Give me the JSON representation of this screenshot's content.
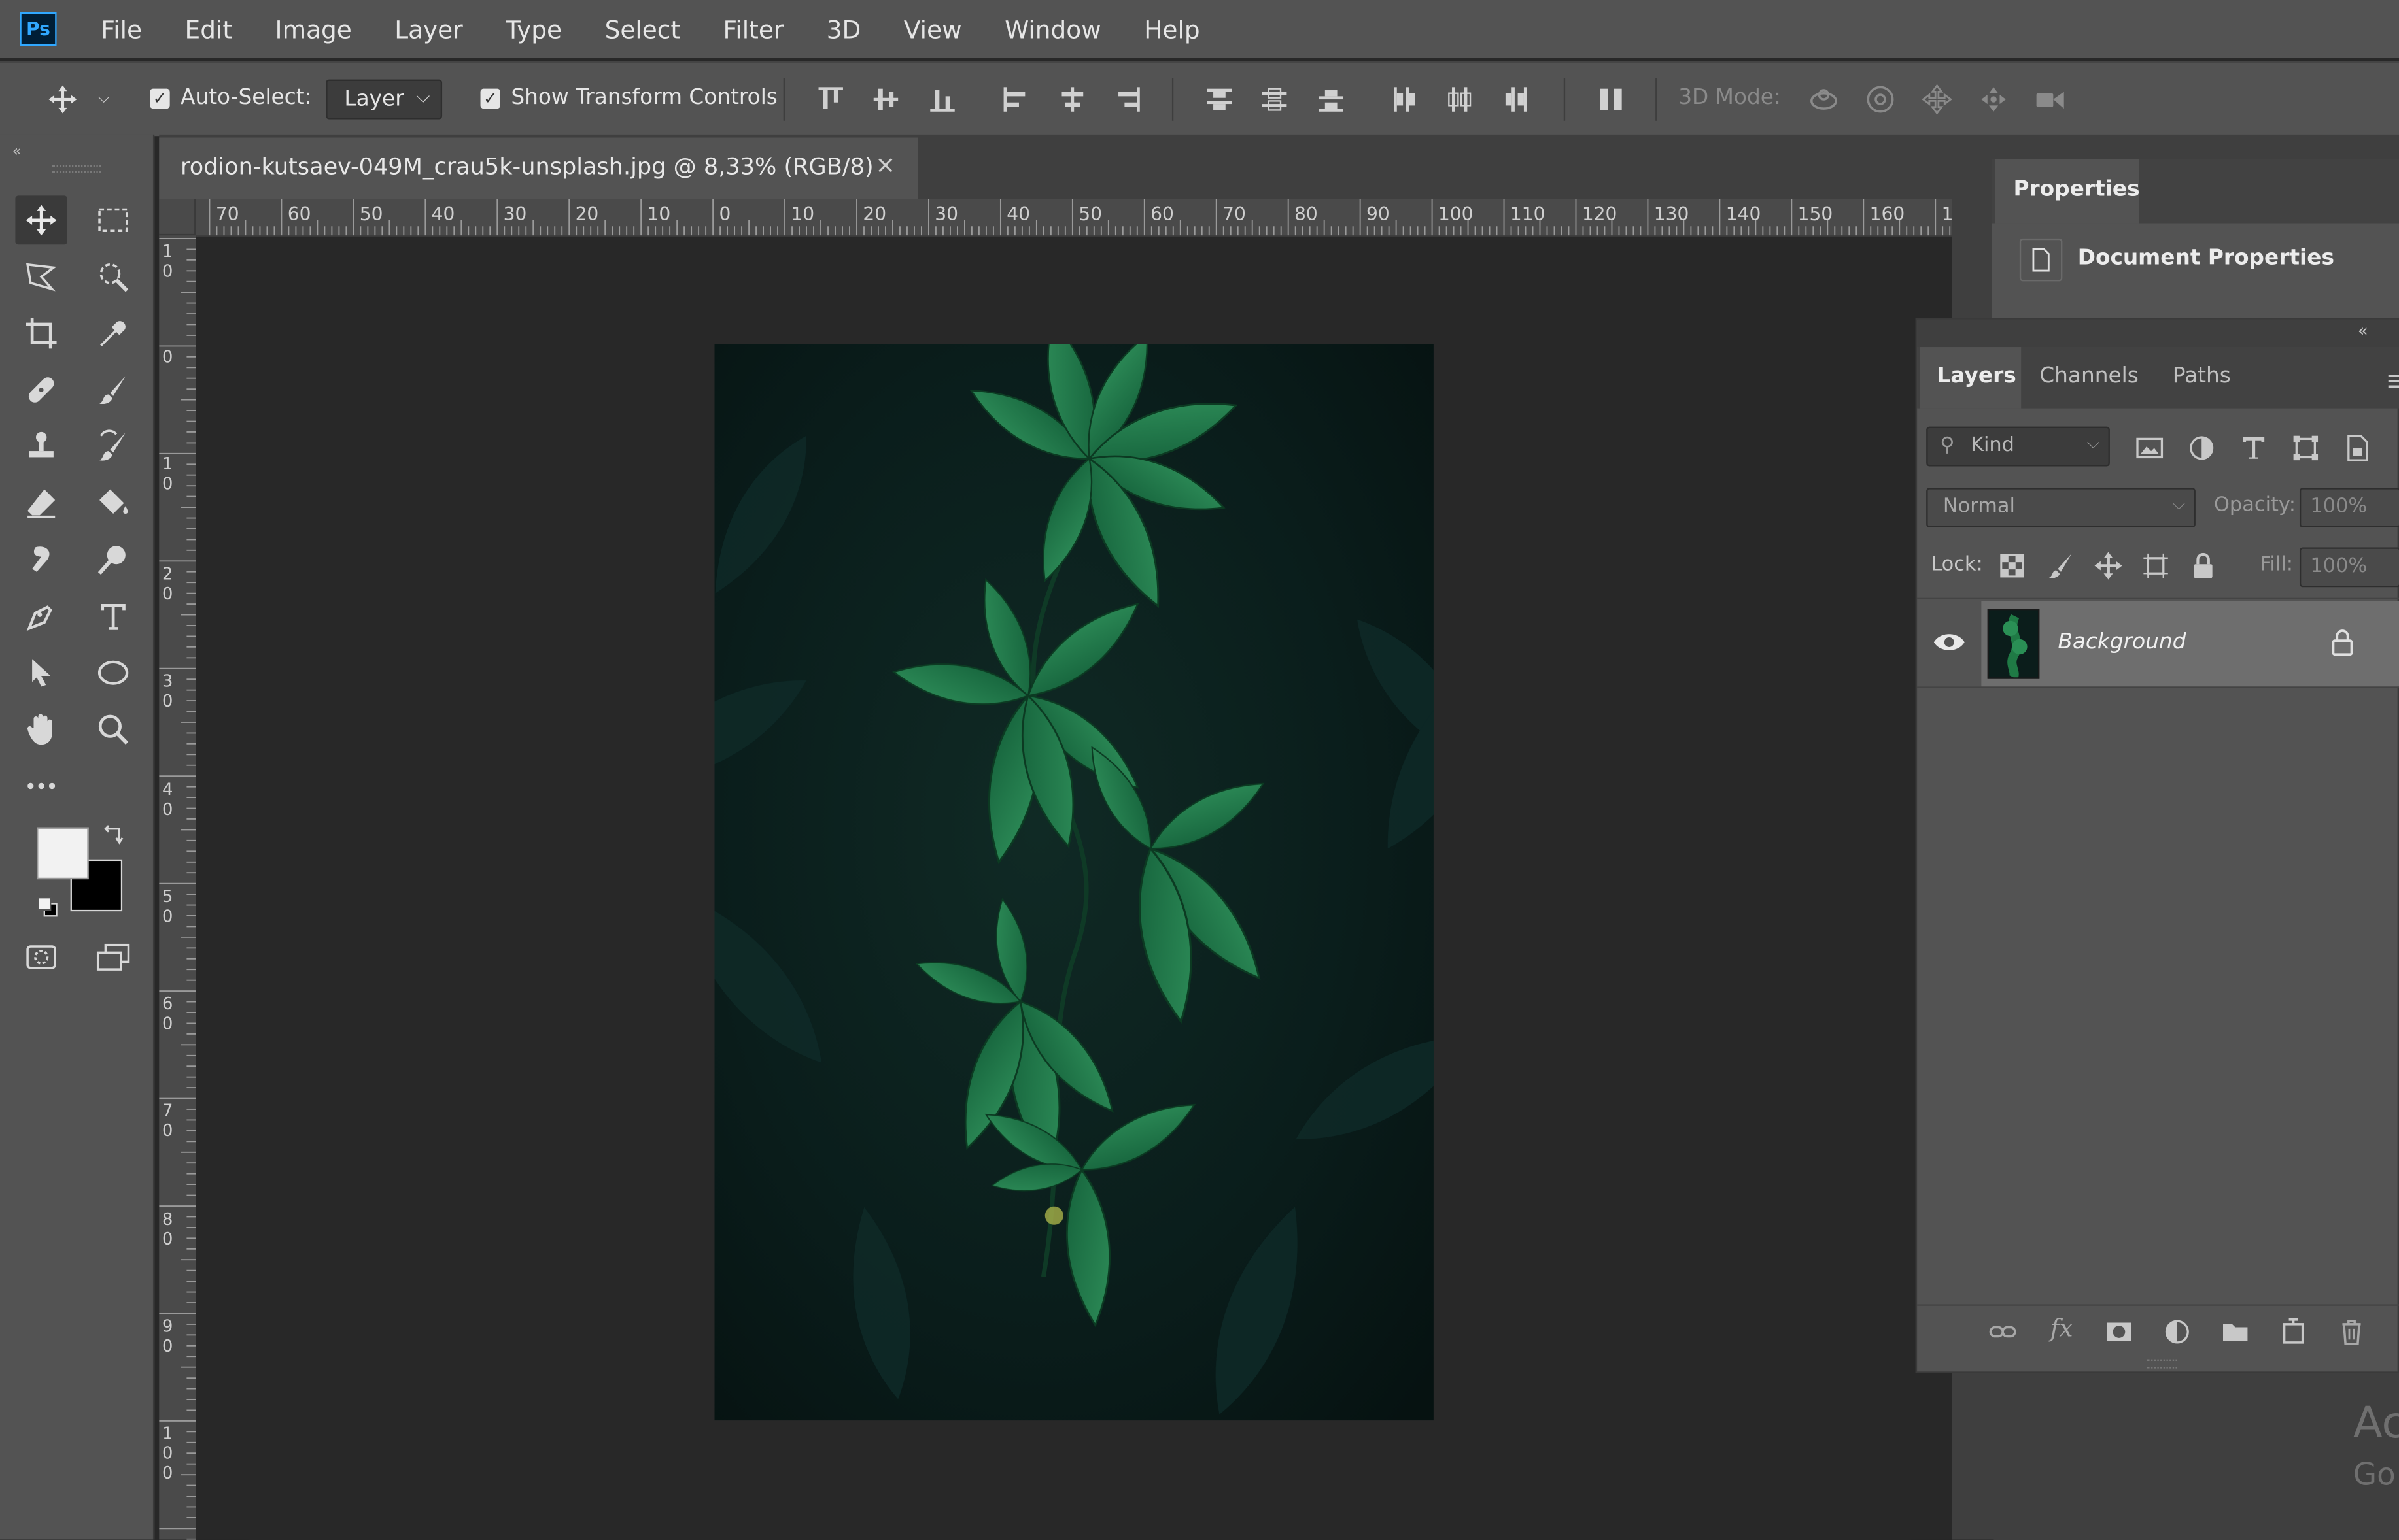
{
  "app": {
    "logo": "Ps"
  },
  "menu": [
    "File",
    "Edit",
    "Image",
    "Layer",
    "Type",
    "Select",
    "Filter",
    "3D",
    "View",
    "Window",
    "Help"
  ],
  "options": {
    "auto_select_label": "Auto-Select:",
    "auto_select_value": "Layer",
    "show_transform_label": "Show Transform Controls",
    "mode3d_label": "3D Mode:"
  },
  "document": {
    "tab_title": "rodion-kutsaev-049M_crau5k-unsplash.jpg @ 8,33% (RGB/8)",
    "close_glyph": "×",
    "ruler_top": [
      "70",
      "60",
      "50",
      "40",
      "30",
      "20",
      "10",
      "0",
      "10",
      "20",
      "30",
      "40",
      "50",
      "60",
      "70",
      "80",
      "90",
      "100",
      "110",
      "120",
      "130",
      "140",
      "150",
      "160",
      "1"
    ],
    "ruler_left": [
      "1\n0",
      "0",
      "1\n0",
      "2\n0",
      "3\n0",
      "4\n0",
      "5\n0",
      "6\n0",
      "7\n0",
      "8\n0",
      "9\n0",
      "1\n0\n0"
    ]
  },
  "properties": {
    "tab": "Properties",
    "item": "Document Properties"
  },
  "layers": {
    "tabs": [
      "Layers",
      "Channels",
      "Paths"
    ],
    "kind_placeholder": "Kind",
    "blend_mode": "Normal",
    "opacity_label": "Opacity:",
    "opacity_value": "100%",
    "lock_label": "Lock:",
    "fill_label": "Fill:",
    "fill_value": "100%",
    "items": [
      {
        "name": "Background",
        "visible": true,
        "locked": true
      }
    ]
  },
  "watermark": {
    "line1": "Activ",
    "line2": "Go to"
  },
  "colors": {
    "foreground": "#f2f2f2",
    "background": "#000000",
    "accent": "#31a8ff"
  }
}
